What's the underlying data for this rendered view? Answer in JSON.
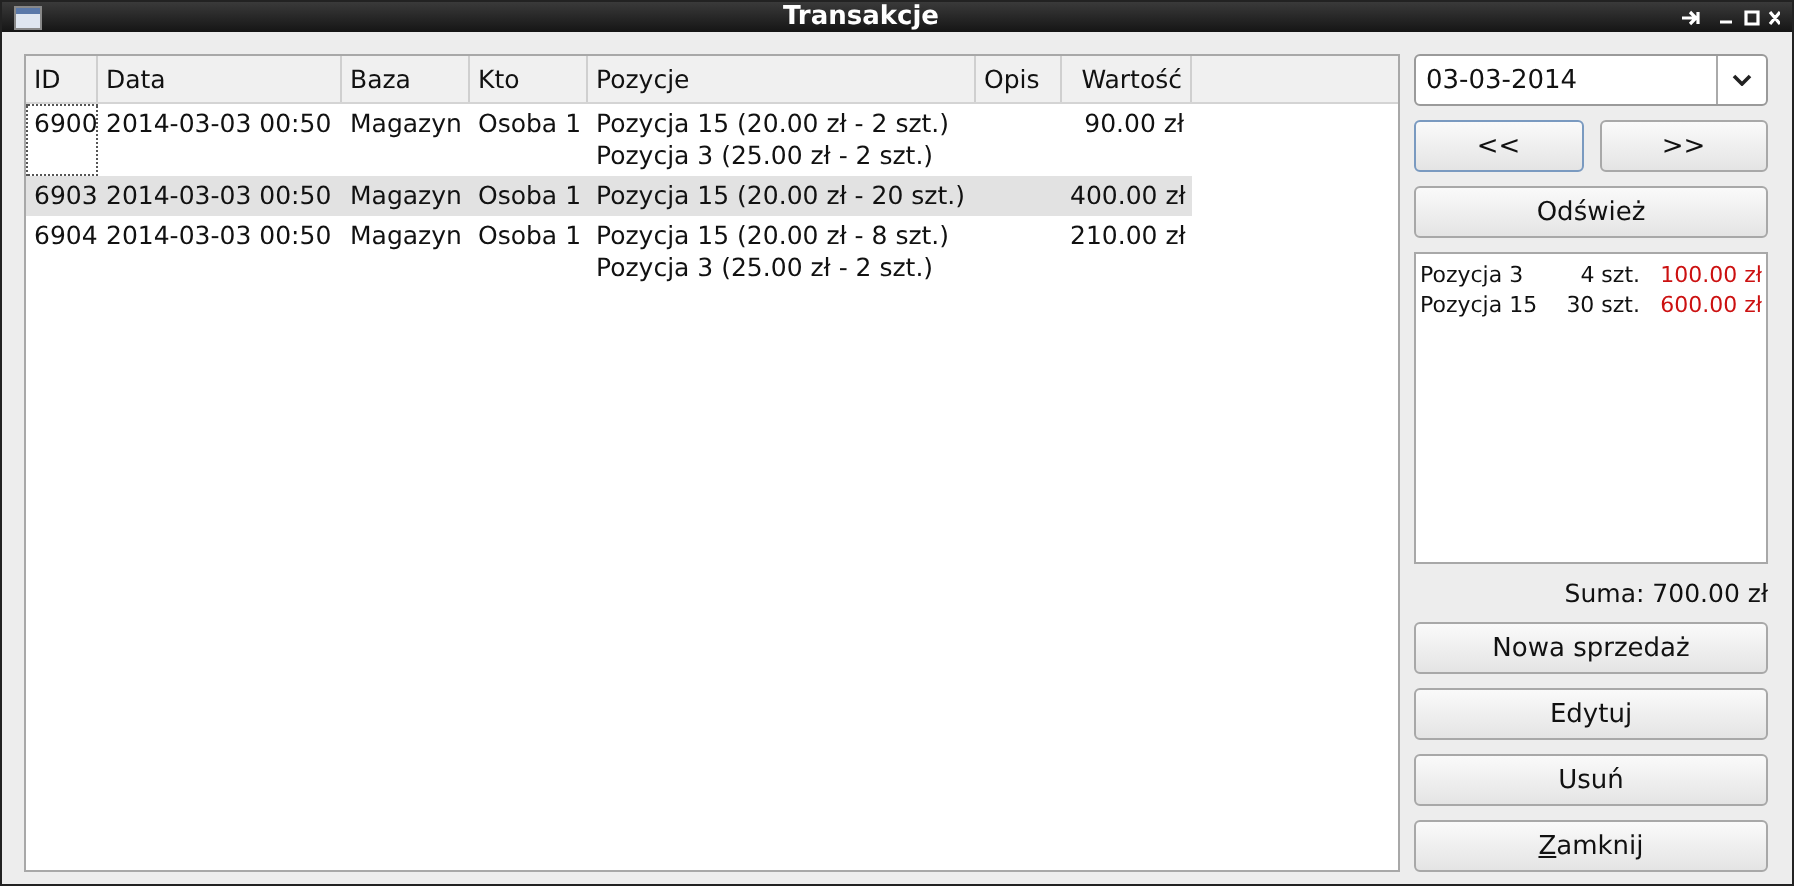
{
  "window": {
    "title": "Transakcje"
  },
  "table": {
    "columns": [
      "ID",
      "Data",
      "Baza",
      "Kto",
      "Pozycje",
      "Opis",
      "Wartość"
    ],
    "rows": [
      {
        "id": "6900",
        "date": "2014-03-03 00:50",
        "base": "Magazyn",
        "who": "Osoba 1",
        "items": [
          "Pozycja 15 (20.00 zł - 2 szt.)",
          "Pozycja 3 (25.00 zł - 2 szt.)"
        ],
        "value": "90.00 zł",
        "selected": false,
        "focused": true
      },
      {
        "id": "6903",
        "date": "2014-03-03 00:50",
        "base": "Magazyn",
        "who": "Osoba 1",
        "items": [
          "Pozycja 15 (20.00 zł - 20 szt.)"
        ],
        "value": "400.00 zł",
        "selected": true,
        "focused": false
      },
      {
        "id": "6904",
        "date": "2014-03-03 00:50",
        "base": "Magazyn",
        "who": "Osoba 1",
        "items": [
          "Pozycja 15 (20.00 zł - 8 szt.)",
          "Pozycja 3 (25.00 zł - 2 szt.)"
        ],
        "value": "210.00 zł",
        "selected": false,
        "focused": false
      }
    ]
  },
  "date_field": {
    "value": "03-03-2014"
  },
  "nav_buttons": [
    {
      "label": "<<",
      "focused": true
    },
    {
      "label": ">>",
      "focused": false
    }
  ],
  "refresh_button": "Odśwież",
  "summary": [
    {
      "name": "Pozycja 3",
      "qty": "4 szt.",
      "amount": "100.00 zł"
    },
    {
      "name": "Pozycja 15",
      "qty": "30 szt.",
      "amount": "600.00 zł"
    }
  ],
  "total": "Suma: 700.00 zł",
  "buttons": [
    {
      "label": "Nowa sprzedaż",
      "mnemonic": false
    },
    {
      "label": "Edytuj",
      "mnemonic": false
    },
    {
      "label": "Usuń",
      "mnemonic": false
    },
    {
      "label": "Zamknij",
      "mnemonic": true
    }
  ]
}
